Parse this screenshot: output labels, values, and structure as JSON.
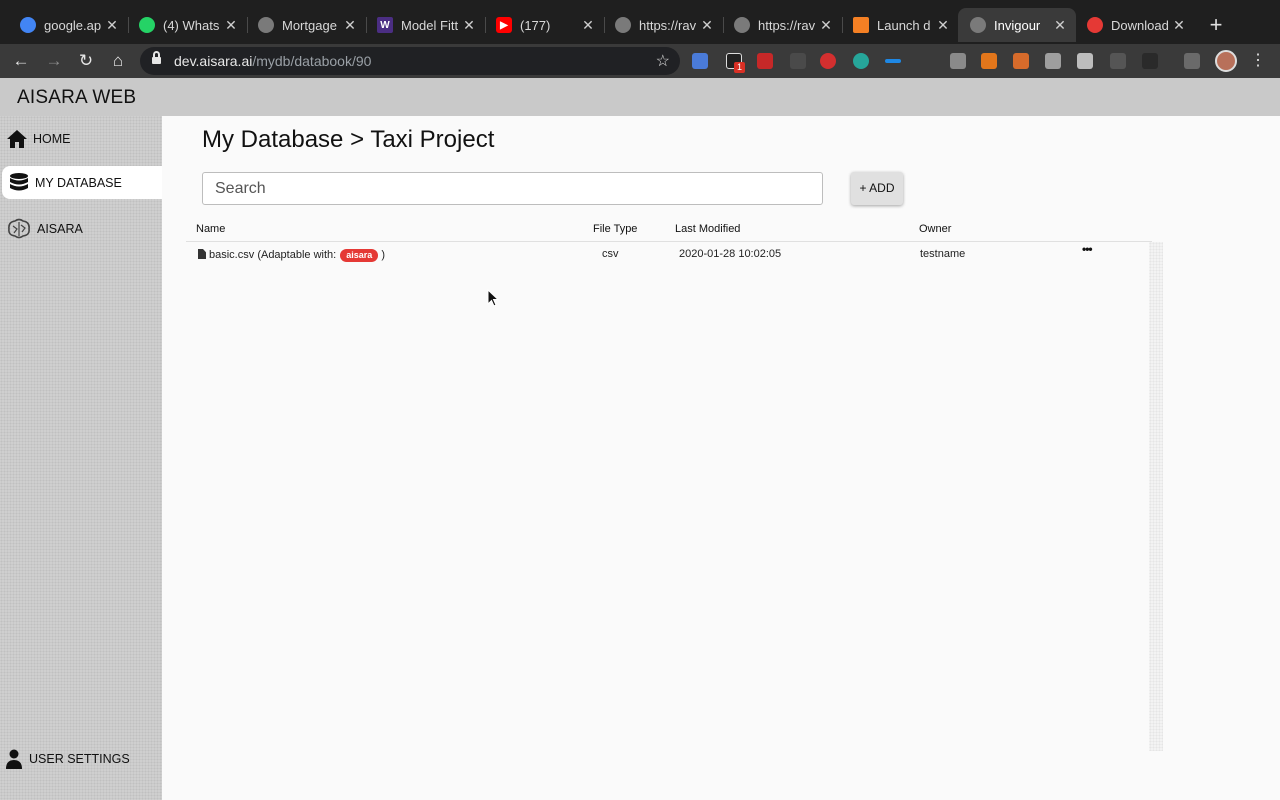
{
  "browser": {
    "tabs": [
      {
        "title": "google.ap",
        "color": "#4285f4"
      },
      {
        "title": "(4) Whats",
        "color": "#25d366"
      },
      {
        "title": "Mortgage",
        "color": "#7a7a7a"
      },
      {
        "title": "Model Fitt",
        "color": "#4b2e83"
      },
      {
        "title": "(177)",
        "color": "#ff0000"
      },
      {
        "title": "https://rav",
        "color": "#7a7a7a"
      },
      {
        "title": "https://rav",
        "color": "#7a7a7a"
      },
      {
        "title": "Launch d",
        "color": "#f48024"
      },
      {
        "title": "Invigour",
        "color": "#7a7a7a"
      },
      {
        "title": "Download",
        "color": "#e53935"
      }
    ],
    "url_domain": "dev.aisara.ai",
    "url_path": "/mydb/databook/90",
    "extension_badge": "1"
  },
  "app": {
    "brand": "AISARA WEB",
    "nav": {
      "home": "HOME",
      "my_database": "MY DATABASE",
      "aisara": "AISARA",
      "user_settings": "USER SETTINGS"
    },
    "page_title": "My Database > Taxi Project",
    "search": {
      "placeholder": "Search",
      "value": ""
    },
    "add_button": "+ ADD",
    "table": {
      "headers": {
        "name": "Name",
        "file_type": "File Type",
        "last_modified": "Last Modified",
        "owner": "Owner"
      },
      "rows": [
        {
          "name": "basic.csv",
          "adaptable_prefix": "(Adaptable with:",
          "badge": "aisara",
          "adaptable_suffix": ")",
          "file_type": "csv",
          "last_modified": "2020-01-28 10:02:05",
          "owner": "testname",
          "menu": "•••"
        }
      ]
    }
  }
}
